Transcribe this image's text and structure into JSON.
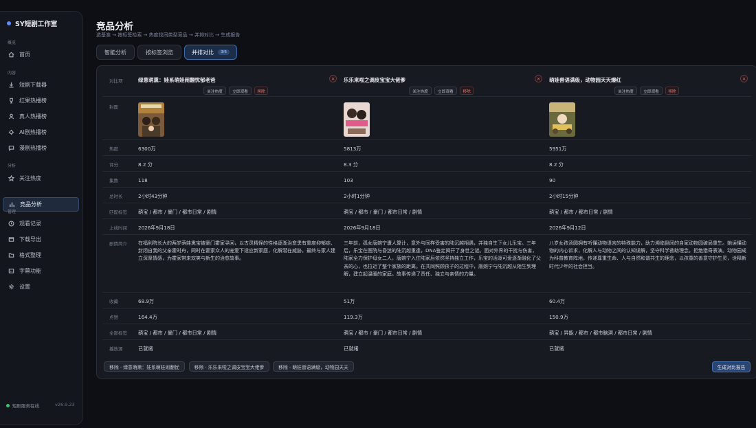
{
  "app": {
    "title": "SY短剧工作室",
    "status": "短剧服务在线",
    "version": "v26.9.23"
  },
  "sidebar": {
    "sections": [
      "概览",
      "内容",
      "分析",
      "管理"
    ],
    "items": [
      {
        "label": "首页",
        "icon": "home-icon"
      },
      {
        "label": "短剧下载器",
        "icon": "download-icon"
      },
      {
        "label": "红果热播榜",
        "icon": "trophy-icon"
      },
      {
        "label": "真人热播榜",
        "icon": "user-icon"
      },
      {
        "label": "AI剧热播榜",
        "icon": "ai-icon"
      },
      {
        "label": "漫剧热播榜",
        "icon": "chat-icon"
      },
      {
        "label": "关注热度",
        "icon": "star-icon"
      },
      {
        "label": "竞品分析",
        "icon": "bar-chart-icon"
      },
      {
        "label": "观看记录",
        "icon": "clock-icon"
      },
      {
        "label": "下载导出",
        "icon": "export-icon"
      },
      {
        "label": "格式整理",
        "icon": "folder-icon"
      },
      {
        "label": "字幕功能",
        "icon": "subtitle-icon"
      },
      {
        "label": "设置",
        "icon": "gear-icon"
      }
    ]
  },
  "header": {
    "title": "竞品分析",
    "subtitle": "选基准 → 按标签检索 → 热度找同类型竞品 → 并排对比 → 生成报告"
  },
  "tabs": [
    {
      "label": "智能分析"
    },
    {
      "label": "按标签浏览"
    },
    {
      "label": "并排对比",
      "badge": "3/6"
    }
  ],
  "compare": {
    "header_label": "对比项",
    "actions": {
      "follow": "关注热度",
      "watch": "立即观看",
      "remove": "移除"
    },
    "labels": [
      "封面",
      "热度",
      "评分",
      "集数",
      "总时长",
      "匹配标签",
      "上线时间",
      "剧情简介",
      "收藏",
      "点赞",
      "全部标签",
      "播放源"
    ],
    "dramas": [
      {
        "title": "绿意萌熏：娃系萌娃闹翻忧郁老爸",
        "heat": "6300万",
        "score": "8.2 分",
        "episodes": "118",
        "duration": "2小时43分钟",
        "match_tags": "萌宝 / 都市 / 豪门 / 都市日常 / 剧情",
        "release": "2026年9月18日",
        "synopsis": "在福利院长大的两岁萌娃熏宝被豪门霍家寻回，以古灵精怪的性格逐渐治愈患有重度抑郁症、封闭自我的父亲霍时舟，同时在霍家众人的宠爱下适应新家庭，化解潜在威胁，最终与家人建立深厚情感，为霍家带来欢笑与新生的治愈故事。",
        "favorites": "68.9万",
        "likes": "164.4万",
        "all_tags": "萌宝 / 都市 / 豪门 / 都市日常 / 剧情",
        "source": "已就绪"
      },
      {
        "title": "乐乐来啦之调皮宝宝大佬爹",
        "heat": "5813万",
        "score": "8.3 分",
        "episodes": "103",
        "duration": "2小时1分钟",
        "match_tags": "萌宝 / 都市 / 豪门 / 都市日常 / 剧情",
        "release": "2026年9月18日",
        "synopsis": "三年前，孤女唐婉宁遭人算计，意外与同样受害的陆沉越相遇，并独自生下女儿乐宝。三年后，乐宝在医院与昏迷的陆沉越重逢，DNA鉴定揭开了身世之谜。面对外界的干扰与伤害，陆家全力保护母女二人，唐婉宁入住陆家后依然坚持独立工作，乐宝的活泼可爱逐渐融化了父亲的心，也拉近了整个家族的距离。在共同照顾孩子的过程中，唐婉宁与陆沉越从陌生到理解，建立起温暖的家庭。故事传递了责任、独立与亲情的力量。",
        "favorites": "51万",
        "likes": "119.3万",
        "all_tags": "萌宝 / 都市 / 豪门 / 都市日常 / 剧情",
        "source": "已就绪"
      },
      {
        "title": "萌娃兽语满级，动物园天天爆红",
        "heat": "5951万",
        "score": "8.2 分",
        "episodes": "90",
        "duration": "2小时15分钟",
        "match_tags": "萌宝 / 都市 / 都市日常 / 剧情",
        "release": "2026年9月12日",
        "synopsis": "八岁女孩汤圆拥有听懂动物语言的特殊能力，助力濒临倒闭的自家动物园破局重生。她读懂动物的内心诉求，化解人与动物之间的认知误解，坚守科学救助理念，拒绝猎奇表演。动物园成为科普教育阵地，传递尊重生命、人与自然和谐共生的理念，以孩童的善意守护生灵，诠释新时代少年的社会担当。",
        "favorites": "60.4万",
        "likes": "150.9万",
        "all_tags": "萌宝 / 异能 / 都市 / 都市脑洞 / 都市日常 / 剧情",
        "source": "已就绪"
      }
    ],
    "footer": {
      "remove_buttons": [
        "移除 · 绿意萌熏：娃系萌娃闹翻忧",
        "移除 · 乐乐来啦之调皮宝宝大佬爹",
        "移除 · 萌娃兽语满级，动物园天天"
      ],
      "report": "生成对比报告"
    }
  },
  "colors": {
    "accent": "#3e6cb0",
    "danger": "#e07a7a",
    "online": "#3bc46b"
  }
}
